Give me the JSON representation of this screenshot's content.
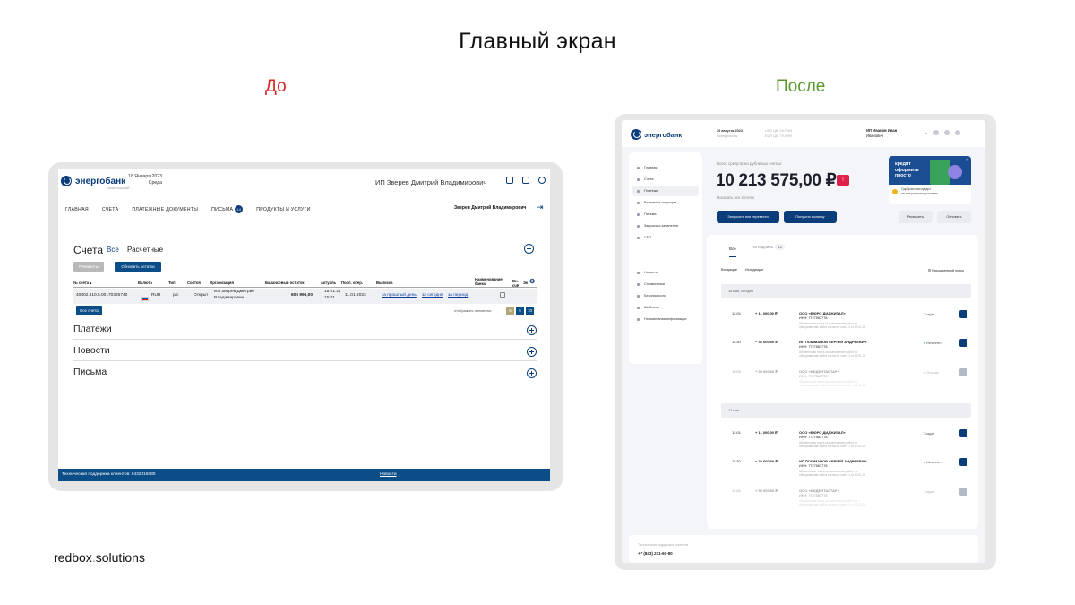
{
  "slide": {
    "title": "Главный экран",
    "before_label": "До",
    "after_label": "После",
    "brand": "redbox",
    "brand_dot": ".",
    "brand_suffix": "solutions",
    "colors": {
      "before": "#d62828",
      "after": "#5a9a2c",
      "brand_blue": "#0b3d7a"
    }
  },
  "old_ui": {
    "logo": "энергобанк",
    "logo_sub": "ТАТАРСТАНСКИЙ",
    "date": "18 Января 2023",
    "weekday": "Среда",
    "user": "ИП Зверев Дмитрий Владимирович",
    "icons": [
      "chat-icon",
      "document-icon",
      "settings-icon"
    ],
    "nav": [
      "ГЛАВНАЯ",
      "СЧЕТА",
      "ПЛАТЕЖНЫЕ ДОКУМЕНТЫ",
      "ПИСЬМА",
      "ПРОДУКТЫ И УСЛУГИ"
    ],
    "letters_badge": "14",
    "user_short": "Зверев Дмитрий Владимирович",
    "accounts_title": "Счета",
    "tab_all": "Все",
    "tab_settle": "Расчетные",
    "btn_requisites": "Реквизиты",
    "btn_refresh": "Обновить остатки",
    "table_headers": [
      "№ счета▲",
      "Валюта",
      "Тип",
      "Состоя",
      "Организация",
      "Балансовый остаток",
      "Актуаль",
      "Посл. опер.",
      "Выписка",
      "Наименование банка",
      "Вн. счё",
      "Эк"
    ],
    "row": {
      "account": "40802.810.5.00170325740",
      "currency": "RUR",
      "type": "р/с",
      "state": "Открыт",
      "org_line1": "ИП Зверев Дмитрий",
      "org_line2": "Владимирович",
      "balance": "605 996,00",
      "actual_line1": "18.01.2(",
      "actual_line2": "15:01",
      "last_op": "11.01.2023",
      "stmt_day": "за прошлый день",
      "stmt_today": "за сегодня",
      "stmt_period": "за период"
    },
    "btn_all_accounts": "Все счета",
    "show_items": "отображать элементы:",
    "pages": [
      "5",
      "5",
      "10"
    ],
    "sections": [
      "Платежи",
      "Новости",
      "Письма"
    ],
    "footer_support": "Техническая поддержка клиентов: 8432316080",
    "footer_news": "Новости"
  },
  "new_ui": {
    "logo": "энергобанк",
    "date": "29 августа 2023",
    "weekday": "Понедельник",
    "rate_usd": "USD ЦБ: 94,7000",
    "rate_eur": "EUR ЦБ: 79,9099",
    "user_line1": "ИП Иванов Иван",
    "user_line2": "Иванович",
    "header_icons": [
      "notification-icon",
      "settings-icon",
      "help-icon"
    ],
    "sidebar": {
      "main": [
        "Главная",
        "Счета",
        "Платежи",
        "Валютные операции",
        "Письма",
        "Запросы и заявления",
        "СБП"
      ],
      "secondary": [
        "Новости",
        "Справочники",
        "Безопасность",
        "Шаблоны",
        "Нормативная информация"
      ]
    },
    "total_label": "Всего средств на рублевых счетах:",
    "total_value": "10 213 575,00 ₽",
    "total_badge": "!",
    "show_all": "Показать все 4 счета",
    "promo": {
      "line1": "кредит",
      "line2": "оформить",
      "line3": "просто",
      "note_line1": "Одобрим вам кредит",
      "note_line2": "на специальных условиях",
      "close": "×"
    },
    "btn_topup": "Запросить или перевести",
    "btn_statement": "Получить выписку",
    "btn_requisites": "Реквизиты",
    "btn_refresh": "Обновить",
    "tabs": {
      "all": "Все",
      "to_sign": "На подпись",
      "to_sign_count": "12"
    },
    "filters": [
      "Входящие",
      "Исходящие"
    ],
    "advanced": "Расширенный поиск",
    "days": [
      {
        "label": "18 мая, сегодня",
        "items": [
          {
            "time": "12:01",
            "amount": "+ 11 000,00 ₽",
            "org": "ООО «БЮРО ДИДЖИТАЛ»",
            "inn": "ИНН: 7727563778",
            "desc": "Абонентская плата за выполнение работ по обслуживанию сайта согласно счета 1 от 10.01.22",
            "status": "Создан",
            "status_type": "new",
            "faded": false
          },
          {
            "time": "11:30",
            "amount": "− 32 000,00 ₽",
            "org": "ИП ПОШМАНОВ СЕРГЕЙ АНДРЕЕВИЧ",
            "inn": "ИНН: 7727563778",
            "desc": "Абонентская плата за выполнение работ по обслуживанию сайта согласно счета 1 от 10.01.22",
            "status": "Исполнен",
            "status_type": "ok",
            "faded": false
          },
          {
            "time": "10:00",
            "amount": "+ 50 000,00 ₽",
            "org": "ООО «МЕДЕНТАСТАР»",
            "inn": "ИНН: 7727563778",
            "desc": "Абонентская плата за выполнение работ по обслуживанию сайта согласно счета 1 от 10.01.22",
            "status": "Отказан",
            "status_type": "rej",
            "faded": true
          }
        ]
      },
      {
        "label": "17 мая",
        "items": [
          {
            "time": "12:01",
            "amount": "+ 11 000,00 ₽",
            "org": "ООО «БЮРО ДИДЖИТАЛ»",
            "inn": "ИНН: 7727563778",
            "desc": "Абонентская плата за выполнение работ по обслуживанию сайта согласно счета 1 от 10.01.22",
            "status": "Создан",
            "status_type": "new",
            "faded": false
          },
          {
            "time": "11:30",
            "amount": "− 32 000,00 ₽",
            "org": "ИП ПОШМАНОВ СЕРГЕЙ АНДРЕЕВИЧ",
            "inn": "ИНН: 7727563778",
            "desc": "Абонентская плата за выполнение работ по обслуживанию сайта согласно счета 1 от 10.01.22",
            "status": "Исполнен",
            "status_type": "ok",
            "faded": false
          },
          {
            "time": "12:01",
            "amount": "+ 50 000,00 ₽",
            "org": "ООО «МЕДЕНТАСТАР»",
            "inn": "ИНН: 7727563778",
            "desc": "Абонентская плата за выполнение работ по обслуживанию сайта согласно счета 1 от 10.01.22",
            "status": "Создан",
            "status_type": "new",
            "faded": true
          }
        ]
      }
    ],
    "footer_label": "Техническая поддержка клиентов",
    "footer_phone": "+7 (843) 231-60-80"
  }
}
